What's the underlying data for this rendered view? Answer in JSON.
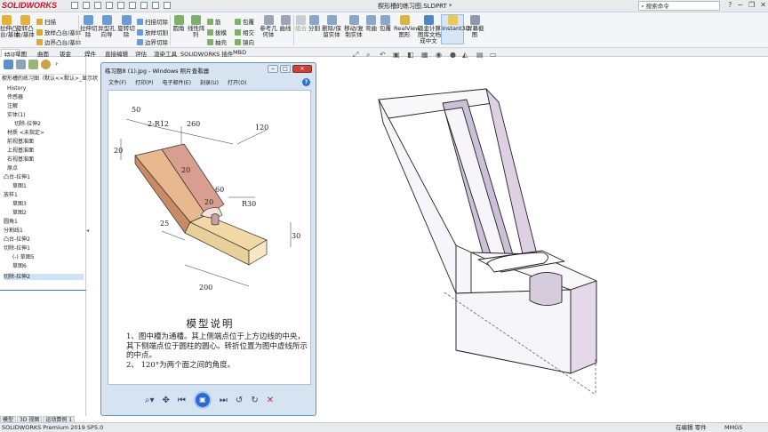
{
  "app": {
    "logo_text": "SOLIDWORKS",
    "doc_title": "楔形槽的练习图.SLDPRT *",
    "search_placeholder": "搜索命令",
    "search_icon": "search-icon"
  },
  "ribbon": {
    "big_buttons": [
      {
        "label": "拉伸凸\n台/基体"
      },
      {
        "label": "旋转凸\n台/基体"
      },
      {
        "label": "拉伸切\n除"
      },
      {
        "label": "异型孔\n向导"
      },
      {
        "label": "旋转切\n除"
      },
      {
        "label": "圆角"
      },
      {
        "label": "线性阵\n列"
      },
      {
        "label": "筋"
      },
      {
        "label": "拔模"
      },
      {
        "label": "抽壳"
      },
      {
        "label": "包覆"
      },
      {
        "label": "相交"
      },
      {
        "label": "镜向"
      },
      {
        "label": "参考几\n何体"
      },
      {
        "label": "曲线"
      },
      {
        "label": "组合"
      },
      {
        "label": "分割"
      },
      {
        "label": "删除/保\n留实体"
      },
      {
        "label": "移动/复\n制实体"
      },
      {
        "label": "弯曲"
      },
      {
        "label": "包覆"
      },
      {
        "label": "RealView\n图形"
      },
      {
        "label": "钣金计算\n图库文档\n成中文"
      },
      {
        "label": "Instant3D"
      },
      {
        "label": "屏幕截\n图"
      }
    ],
    "small_buttons": {
      "sweep": "扫描",
      "loft": "放样凸台/基体",
      "boundary": "边界凸台/基体",
      "sweep_cut": "扫描切除",
      "loft_cut": "放样切割",
      "boundary_cut": "边界切除"
    }
  },
  "tabs": [
    "特征",
    "草图",
    "曲面",
    "钣金",
    "焊件",
    "直接编辑",
    "评估",
    "渲染工具",
    "SOLIDWORKS 插件",
    "MBD"
  ],
  "active_tab": 0,
  "feature_tree": {
    "root": "楔形槽的练习图（默认<<默认>_显示状",
    "items": [
      "History",
      "传感器",
      "注解",
      "实体(1)",
      "切除-拉伸2",
      "材质 <未指定>",
      "前视基准面",
      "上视基准面",
      "右视基准面",
      "原点",
      "凸台-拉伸1",
      "草图1",
      "放样1",
      "草图3",
      "草图2",
      "圆角1",
      "分割线1",
      "凸台-拉伸2",
      "切除-拉伸1",
      "(-) 草图5",
      "草图6",
      "切除-拉伸2"
    ]
  },
  "bottom_tabs": [
    "模型",
    "3D 视图",
    "运动算例 1"
  ],
  "status": {
    "left": "SOLIDWORKS Premium 2019 SP5.0",
    "editing": "在编辑 零件",
    "units": "MMGS"
  },
  "photo_viewer": {
    "title": "练习题8 (1).jpg - Windows 照片查看器",
    "menu": [
      "文件(F)",
      "打印(P)",
      "电子邮件(E)",
      "刻录(U)",
      "打开(O)"
    ],
    "help": "?",
    "heading": "模型说明",
    "notes": [
      "1、图中槽为通槽。其上侧端点位于上方边线的中央，其下侧端点位于圆柱的圆心。转折位置为图中虚线所示的中点。",
      "2、 120°为两个面之间的角度。"
    ],
    "dimensions": {
      "d50": "50",
      "r12": "2-R12",
      "d260": "260",
      "d120": "120",
      "d20a": "20",
      "d20b": "20",
      "d60": "60",
      "r30": "R30",
      "d20c": "20",
      "d25": "25",
      "d30": "30",
      "d200": "200"
    }
  }
}
